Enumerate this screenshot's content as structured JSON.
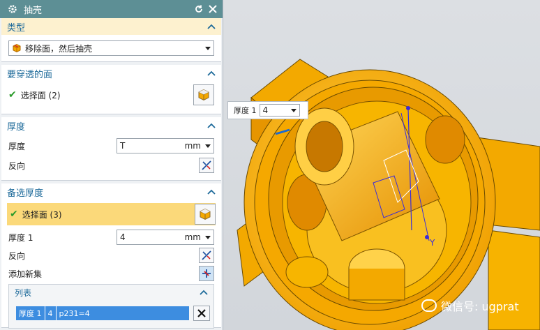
{
  "dialog": {
    "title": "抽壳"
  },
  "type_group": {
    "title": "类型",
    "method_value": "移除面，然后抽壳"
  },
  "pierce_group": {
    "title": "要穿透的面",
    "select_label": "选择面 (2)"
  },
  "thickness_group": {
    "title": "厚度",
    "thickness_label": "厚度",
    "thickness_value": "T",
    "thickness_unit": "mm",
    "reverse_label": "反向"
  },
  "alt_group": {
    "title": "备选厚度",
    "select_label": "选择面 (3)",
    "thickness1_label": "厚度 1",
    "thickness1_value": "4",
    "thickness1_unit": "mm",
    "reverse_label": "反向",
    "add_set_label": "添加新集",
    "list": {
      "title": "列表",
      "row": {
        "name": "厚度 1",
        "count": "4",
        "expr": "p231=4"
      }
    }
  },
  "viewport": {
    "float_label": "厚度 1",
    "float_value": "4",
    "axis_label_y": "Y",
    "watermark": "微信号: ugprat"
  },
  "colors": {
    "accent": "#5d8f95",
    "part": "#f5a800",
    "selection": "#3d8de0",
    "highlight": "#fdf1cf"
  }
}
